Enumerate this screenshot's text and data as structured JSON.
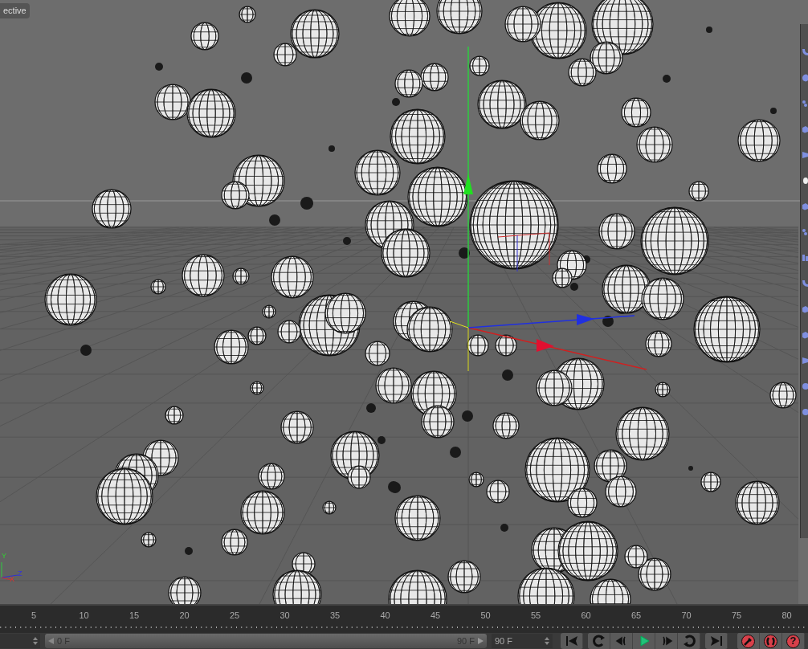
{
  "viewport": {
    "camera_label": "ective",
    "gizmo": {
      "y": "Y",
      "z": "Z",
      "x": "X"
    }
  },
  "timeline": {
    "ticks": [
      "5",
      "10",
      "15",
      "20",
      "25",
      "30",
      "35",
      "40",
      "45",
      "50",
      "55",
      "60",
      "65",
      "70",
      "75",
      "80"
    ]
  },
  "transport": {
    "range": {
      "level": 1
    },
    "range_start": "0 F",
    "range_end": "90 F",
    "end_field": "90 F",
    "buttons": [
      {
        "kind": "first"
      },
      {
        "kind": "loop-back"
      },
      {
        "kind": "prev-key"
      },
      {
        "kind": "play"
      },
      {
        "kind": "next-key"
      },
      {
        "kind": "loop-forward"
      },
      {
        "kind": "last"
      }
    ],
    "record_buttons": [
      {
        "kind": "key"
      },
      {
        "kind": "autokey"
      },
      {
        "kind": "help",
        "glyph": "?"
      }
    ]
  },
  "toolbar": {
    "items": [
      {
        "kind": "bend"
      },
      {
        "kind": "twist"
      },
      {
        "kind": "dots"
      },
      {
        "kind": "cube"
      },
      {
        "kind": "taper"
      },
      {
        "kind": "bulge"
      },
      {
        "kind": "cube"
      },
      {
        "kind": "dots"
      },
      {
        "kind": "bars"
      },
      {
        "kind": "bend"
      },
      {
        "kind": "cube"
      },
      {
        "kind": "cube"
      },
      {
        "kind": "taper"
      },
      {
        "kind": "sphere"
      },
      {
        "kind": "sphere"
      }
    ]
  }
}
